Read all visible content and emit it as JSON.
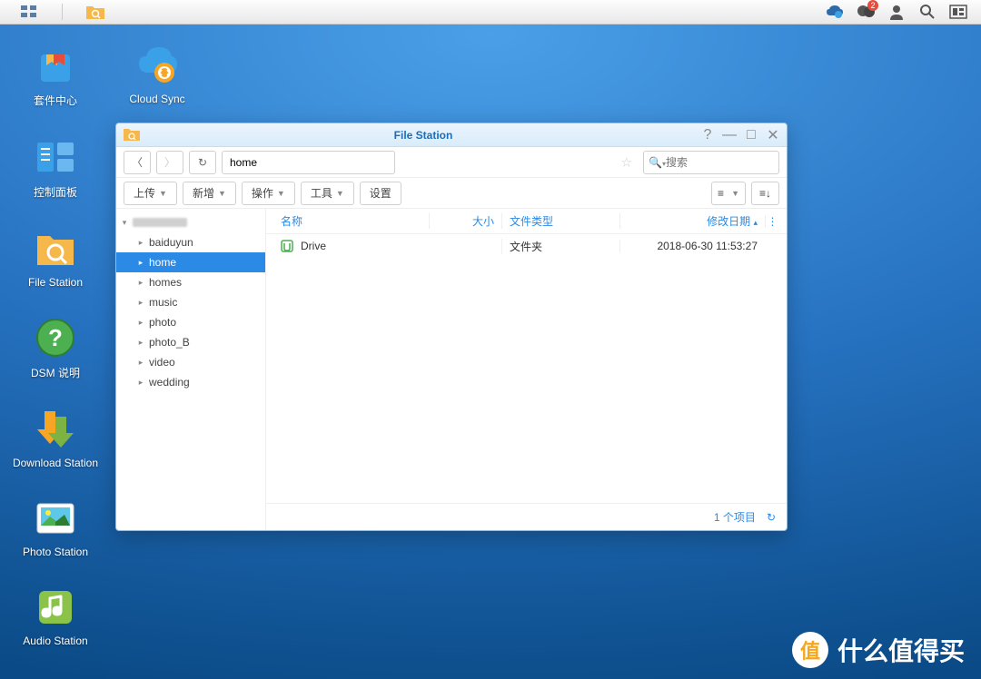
{
  "taskbar": {
    "notification_badge": "2"
  },
  "desktop_icons_col1": [
    {
      "label": "套件中心",
      "key": "package-center"
    },
    {
      "label": "控制面板",
      "key": "control-panel"
    },
    {
      "label": "File Station",
      "key": "file-station"
    },
    {
      "label": "DSM 说明",
      "key": "dsm-help"
    },
    {
      "label": "Download Station",
      "key": "download-station"
    },
    {
      "label": "Photo Station",
      "key": "photo-station"
    },
    {
      "label": "Audio Station",
      "key": "audio-station"
    }
  ],
  "desktop_icons_col2": [
    {
      "label": "Cloud Sync",
      "key": "cloud-sync"
    }
  ],
  "filestation": {
    "title": "File Station",
    "path_value": "home",
    "search_placeholder": "搜索",
    "toolbar": {
      "upload": "上传",
      "create": "新增",
      "action": "操作",
      "tools": "工具",
      "settings": "设置"
    },
    "tree": [
      {
        "label": "baiduyun"
      },
      {
        "label": "home"
      },
      {
        "label": "homes"
      },
      {
        "label": "music"
      },
      {
        "label": "photo"
      },
      {
        "label": "photo_B"
      },
      {
        "label": "video"
      },
      {
        "label": "wedding"
      }
    ],
    "tree_selected": "home",
    "columns": {
      "name": "名称",
      "size": "大小",
      "type": "文件类型",
      "date": "修改日期"
    },
    "rows": [
      {
        "name": "Drive",
        "size": "",
        "type": "文件夹",
        "date": "2018-06-30 11:53:27"
      }
    ],
    "footer_count": "1 个项目"
  },
  "watermark": "什么值得买"
}
